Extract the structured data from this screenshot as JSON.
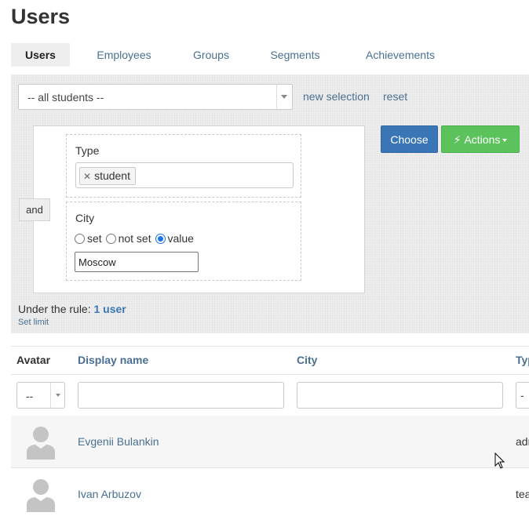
{
  "page": {
    "title": "Users"
  },
  "tabs": [
    {
      "label": "Users",
      "active": true
    },
    {
      "label": "Employees",
      "active": false
    },
    {
      "label": "Groups",
      "active": false
    },
    {
      "label": "Segments",
      "active": false
    },
    {
      "label": "Achievements",
      "active": false
    }
  ],
  "filter": {
    "selection_value": "-- all students --",
    "new_selection_label": "new selection",
    "reset_label": "reset",
    "operator_label": "and",
    "conditions": {
      "type": {
        "label": "Type",
        "tags": [
          "student"
        ]
      },
      "city": {
        "label": "City",
        "options": [
          "set",
          "not set",
          "value"
        ],
        "selected": "value",
        "value": "Moscow"
      }
    },
    "choose_label": "Choose",
    "actions_label": "Actions",
    "result_prefix": "Under the rule:",
    "result_count": "1 user",
    "set_limit_label": "Set limit"
  },
  "table": {
    "columns": [
      "Avatar",
      "Display name",
      "City",
      "Typ"
    ],
    "avatar_filter_value": "--",
    "type_filter_value": "-",
    "rows": [
      {
        "display_name": "Evgenii Bulankin",
        "city": "",
        "type": "adr"
      },
      {
        "display_name": "Ivan Arbuzov",
        "city": "",
        "type": "tea"
      }
    ]
  },
  "colors": {
    "link": "#4a6f91",
    "choose_button": "#3a76b5",
    "actions_button": "#5cc25c",
    "panel_background": "#eeeeee"
  }
}
